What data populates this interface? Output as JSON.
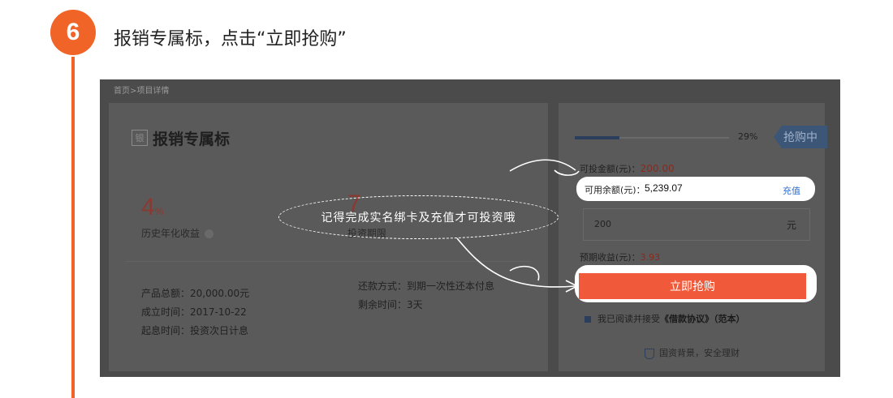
{
  "step": {
    "number": "6",
    "title": "报销专属标，点击“立即抢购”"
  },
  "breadcrumb": "首页>项目详情",
  "product": {
    "icon_char": "银",
    "title": "报销专属标",
    "rate_value": "4",
    "rate_unit": "%",
    "rate_label": "历史年化收益",
    "term_value": "7",
    "term_label": "投资期限",
    "details": [
      {
        "label": "产品总额：",
        "value": "20,000.00元"
      },
      {
        "label": "成立时间：",
        "value": "2017-10-22"
      },
      {
        "label": "起息时间：",
        "value": "投资次日计息"
      }
    ],
    "repay": [
      {
        "label": "还款方式：",
        "value": "到期一次性还本付息"
      },
      {
        "label": "剩余时间：",
        "value": "3天"
      }
    ]
  },
  "purchase": {
    "progress": 0.29,
    "progress_text": "29%",
    "status": "抢购中",
    "investable_label": "可投金额(元)：",
    "investable_value": "200.00",
    "balance_label": "可用余额(元)：",
    "balance_value": "5,239.07",
    "recharge_label": "充值",
    "amount_value": "200",
    "amount_unit": "元",
    "expected_label": "预期收益(元)：",
    "expected_value": "3.93",
    "buy_label": "立即抢购",
    "agree_text": "我已阅读并接受",
    "agree_link": "《借款协议》（范本）",
    "safety_text": "国资背景，安全理财"
  },
  "annotation": "记得完成实名绑卡及充值才可投资哦",
  "colors": {
    "accent": "#f06427",
    "buy_button": "#f0593a",
    "status_tag": "#3c5678",
    "link": "#2a6fd6"
  }
}
